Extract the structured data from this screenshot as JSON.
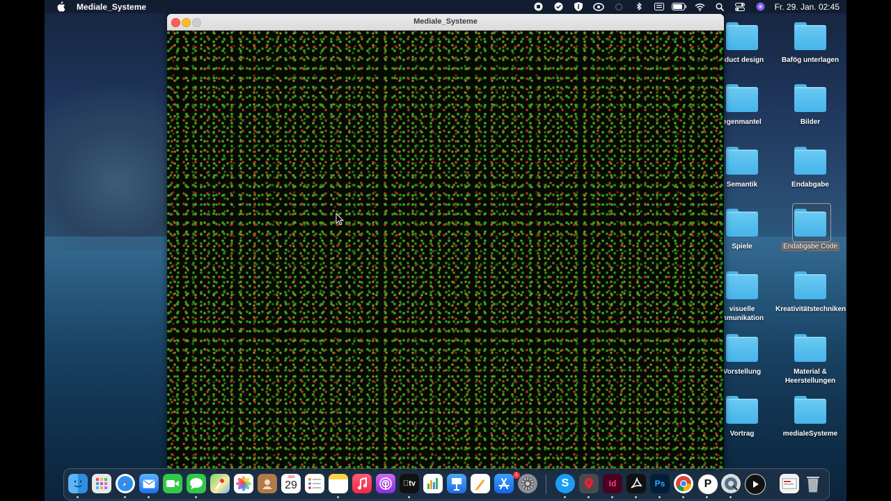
{
  "menubar": {
    "app_name": "Mediale_Systeme",
    "clock": "Fr. 29. Jan.  02:45",
    "status_icons": [
      "record-icon",
      "check-icon",
      "shield-icon",
      "infinity-icon",
      "sync-icon",
      "bluetooth-icon",
      "keyboard-icon",
      "battery-icon",
      "wifi-icon",
      "search-icon",
      "control-center-icon",
      "siri-icon"
    ]
  },
  "window": {
    "title": "Mediale_Systeme"
  },
  "desktop": {
    "icons": [
      {
        "label": "oduct design"
      },
      {
        "label": "Bafög unterlagen"
      },
      {
        "label": "egenmantel"
      },
      {
        "label": "Bilder"
      },
      {
        "label": "Semantik"
      },
      {
        "label": "Endabgabe"
      },
      {
        "label": "Spiele"
      },
      {
        "label": "Endabgabe Code"
      },
      {
        "label": "visuelle mmunikation"
      },
      {
        "label": "Kreativitätstechniken"
      },
      {
        "label": "Vorstellung"
      },
      {
        "label": "Material & Heerstellungen"
      },
      {
        "label": "Vortrag"
      },
      {
        "label": "medialeSysteme"
      }
    ]
  },
  "dock": {
    "calendar_month": "JAN",
    "calendar_day": "29",
    "appstore_badge": "1",
    "tv_label": "tv",
    "skype_label": "S",
    "indesign_label": "Id",
    "photoshop_label": "Ps",
    "p_label": "P"
  }
}
